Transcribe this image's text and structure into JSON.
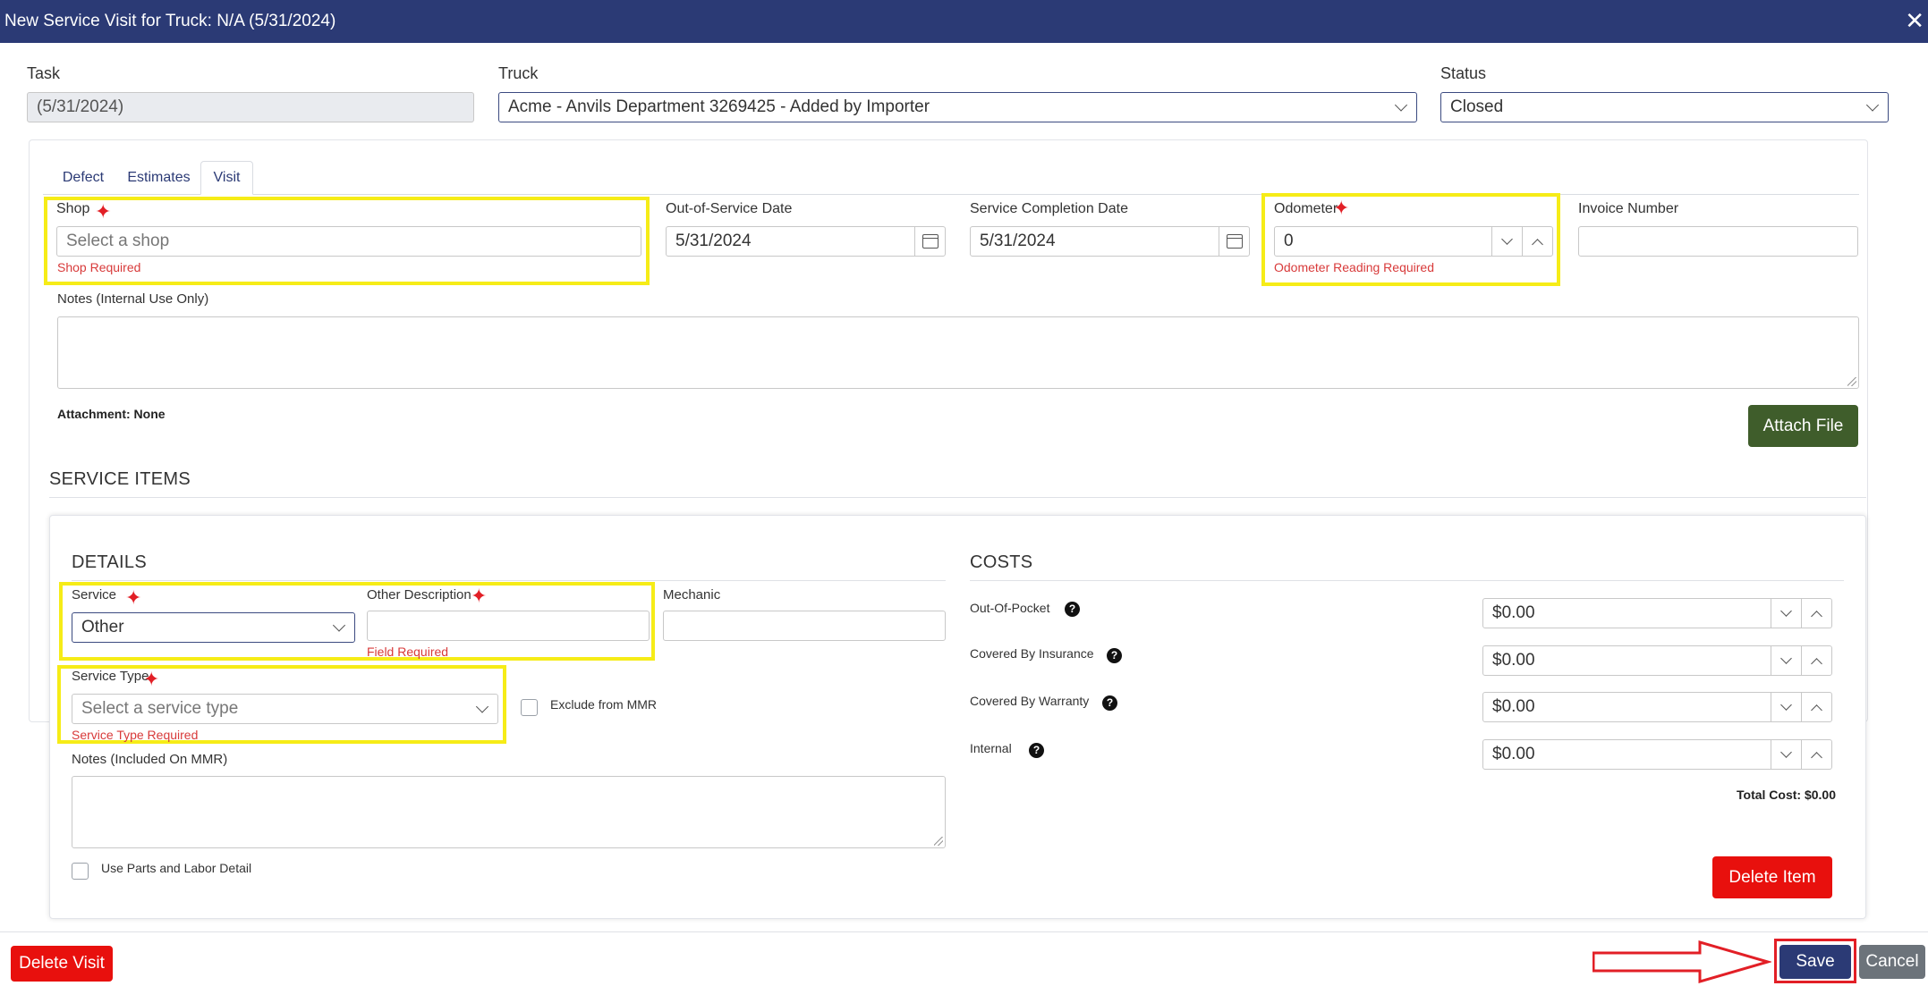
{
  "header": {
    "title": "New Service Visit for Truck: N/A (5/31/2024)"
  },
  "top": {
    "task_label": "Task",
    "task_value": "(5/31/2024)",
    "truck_label": "Truck",
    "truck_value": "Acme - Anvils Department 3269425 - Added by Importer",
    "status_label": "Status",
    "status_value": "Closed"
  },
  "tabs": [
    {
      "label": "Defect"
    },
    {
      "label": "Estimates"
    },
    {
      "label": "Visit"
    }
  ],
  "visit": {
    "shop_label": "Shop",
    "shop_placeholder": "Select a shop",
    "shop_error": "Shop Required",
    "oos_label": "Out-of-Service Date",
    "oos_value": "5/31/2024",
    "completion_label": "Service Completion Date",
    "completion_value": "5/31/2024",
    "odometer_label": "Odometer",
    "odometer_value": "0",
    "odometer_error": "Odometer Reading Required",
    "invoice_label": "Invoice Number",
    "notes_label": "Notes (Internal Use Only)",
    "attachment_text": "Attachment: None",
    "attach_button": "Attach File"
  },
  "service_items": {
    "heading": "SERVICE ITEMS",
    "details_heading": "DETAILS",
    "service_label": "Service",
    "service_value": "Other",
    "other_desc_label": "Other Description",
    "other_desc_error": "Field Required",
    "mechanic_label": "Mechanic",
    "service_type_label": "Service Type",
    "service_type_placeholder": "Select a service type",
    "service_type_error": "Service Type Required",
    "exclude_label": "Exclude from MMR",
    "notes_label": "Notes (Included On MMR)",
    "parts_label": "Use Parts and Labor Detail",
    "costs_heading": "COSTS",
    "costs": [
      {
        "label": "Out-Of-Pocket",
        "value": "$0.00"
      },
      {
        "label": "Covered By Insurance",
        "value": "$0.00"
      },
      {
        "label": "Covered By Warranty",
        "value": "$0.00"
      },
      {
        "label": "Internal",
        "value": "$0.00"
      }
    ],
    "total_cost": "Total Cost: $0.00",
    "delete_item": "Delete Item"
  },
  "footer": {
    "delete_visit": "Delete Visit",
    "save": "Save",
    "cancel": "Cancel"
  },
  "icons": {
    "required": "red-star-icon",
    "help": "question-circle-icon",
    "calendar": "calendar-icon",
    "close": "close-icon"
  },
  "colors": {
    "header": "#2b3a75",
    "danger": "#e8100d",
    "save": "#2b3a75",
    "cancel": "#6c737a",
    "attach": "#3f5d2b",
    "highlight": "#f6ec17",
    "error": "#d83a3a"
  }
}
